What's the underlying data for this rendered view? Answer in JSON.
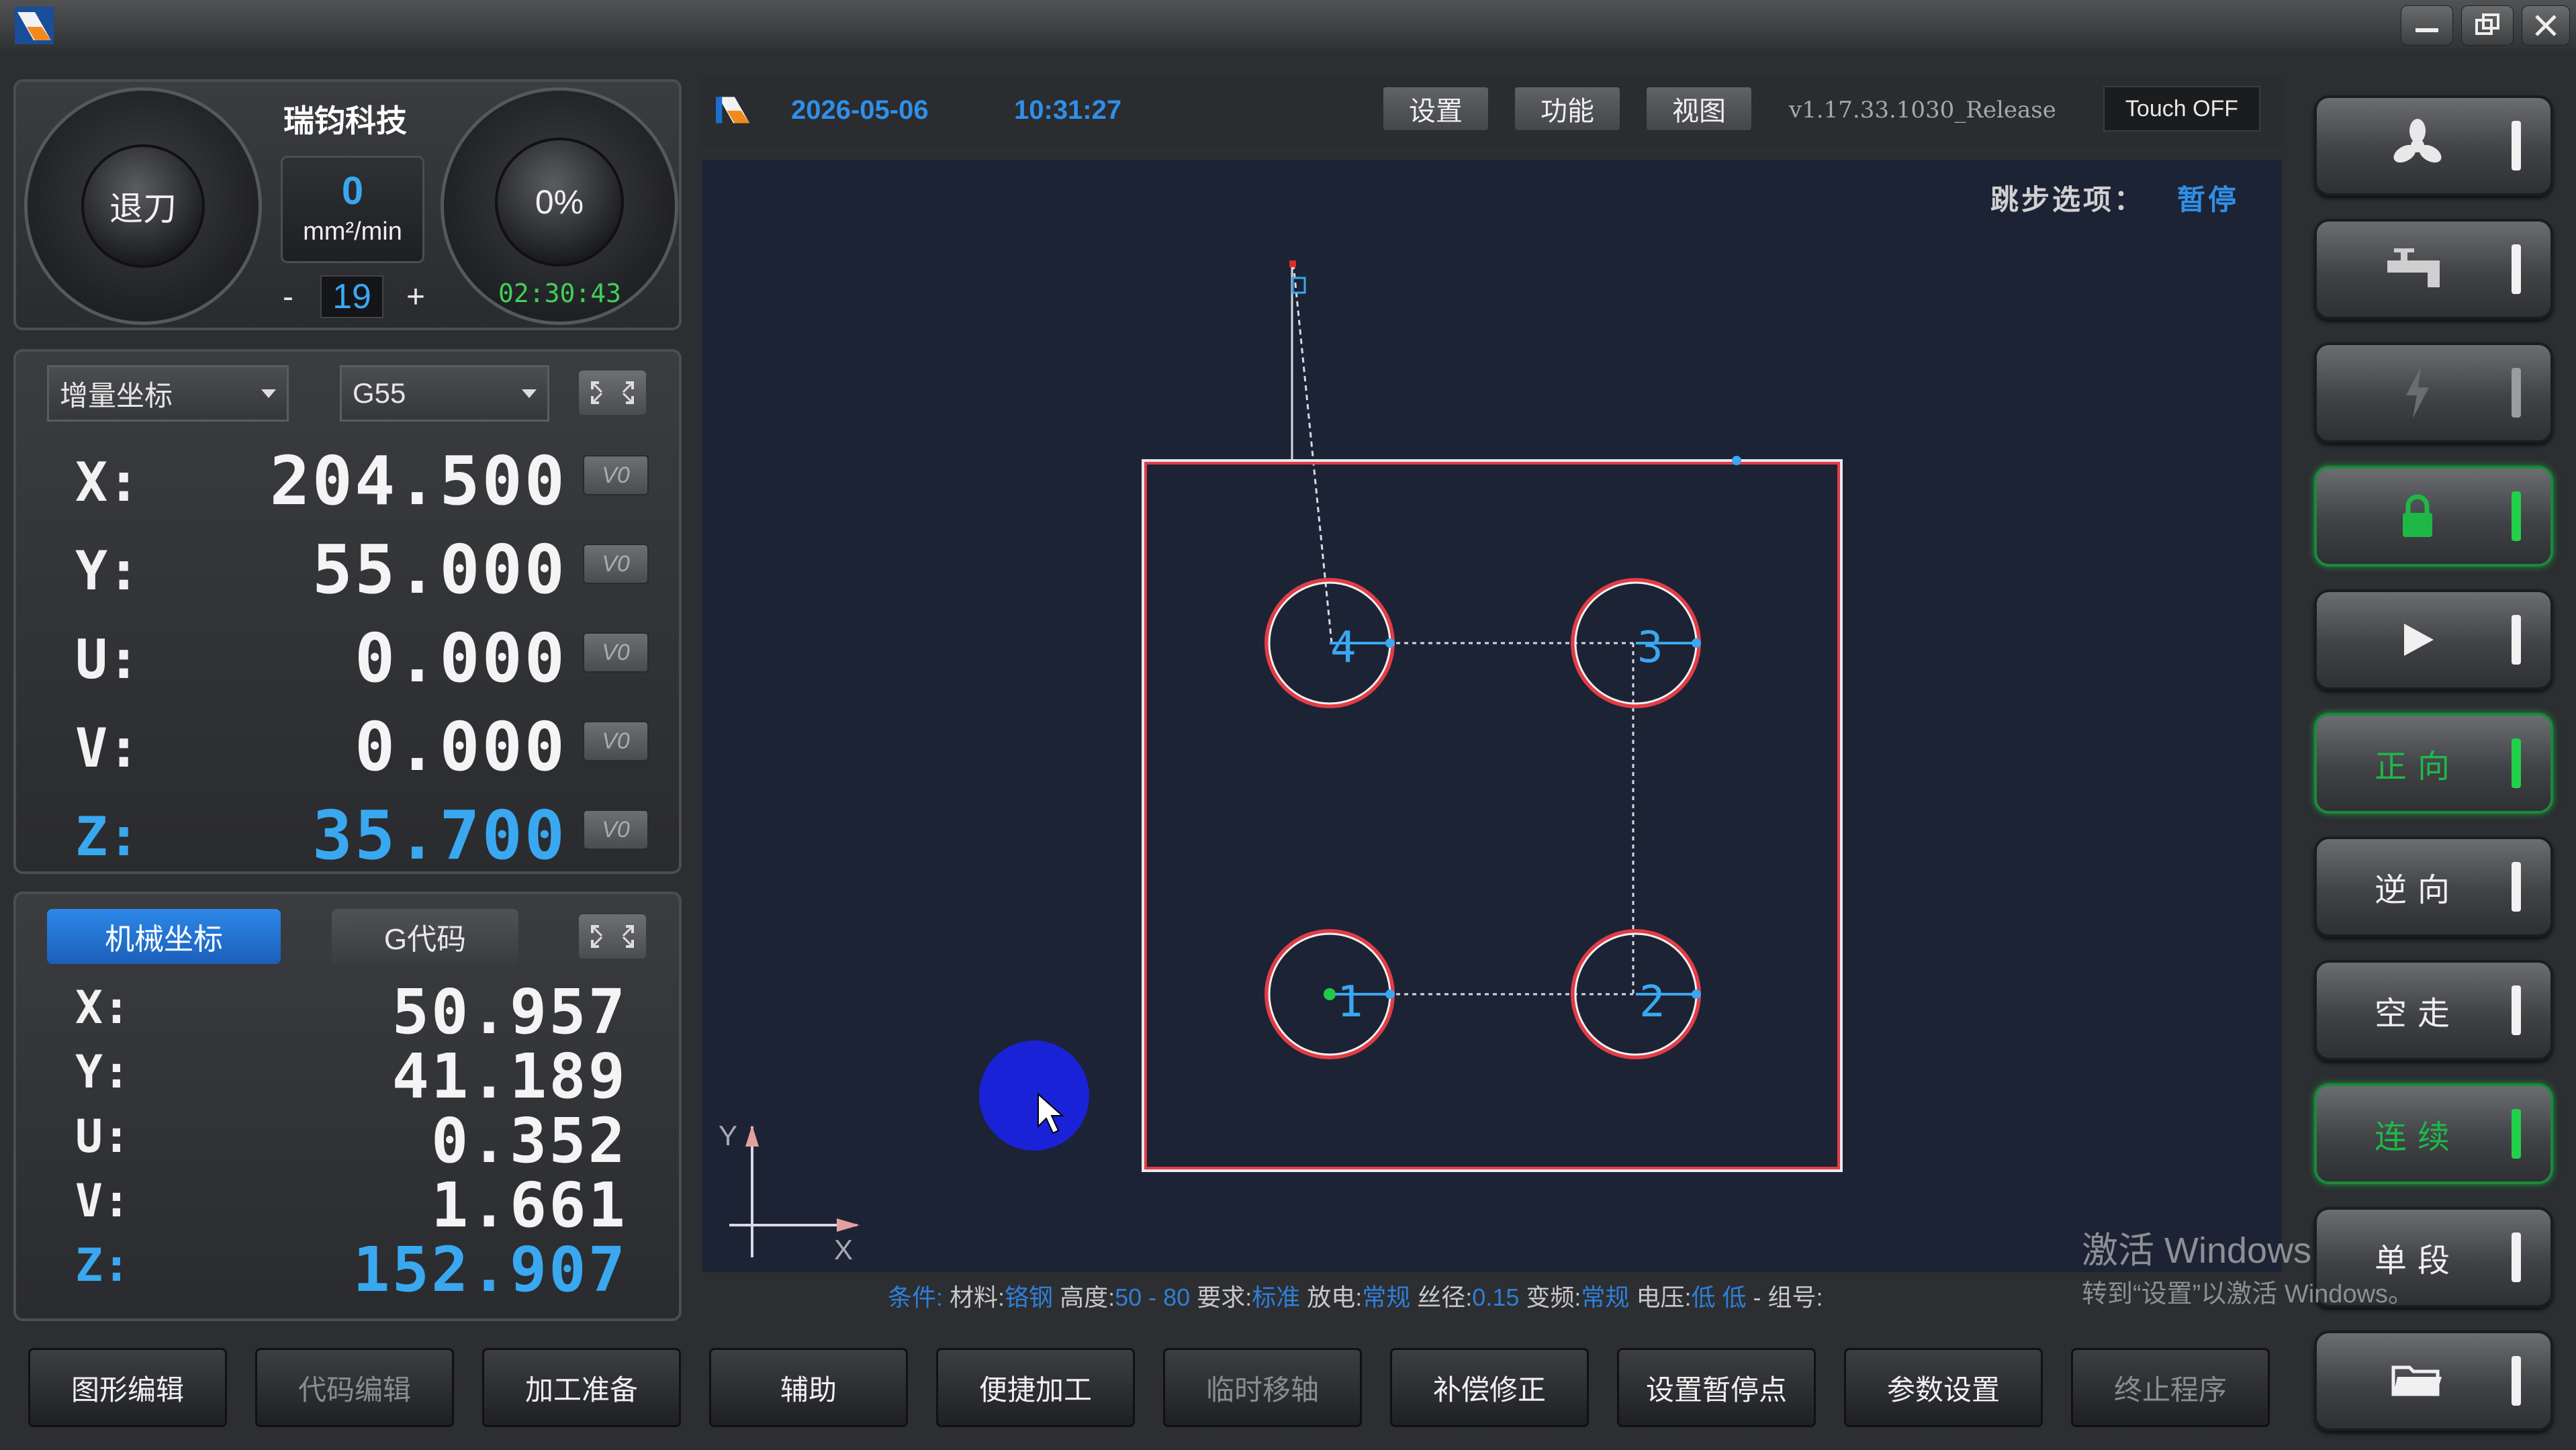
{
  "colors": {
    "accent_blue": "#3aa8f0",
    "active_green": "#22d04a",
    "canvas_bg": "#1c2335",
    "part_outline": "#e23c46",
    "tab_active": "#1f6fd0"
  },
  "dials": {
    "left_label": "退刀",
    "feed_value": "0",
    "feed_unit": "mm²/min",
    "step_minus": "-",
    "step_value": "19",
    "step_plus": "+",
    "right_percent": "0%",
    "timer": "02:30:43"
  },
  "brand": "瑞钧科技",
  "coords_top": {
    "mode": "增量坐标",
    "workcs": "G55",
    "axes": [
      {
        "label": "X:",
        "value": "204.500",
        "btn": "V0"
      },
      {
        "label": "Y:",
        "value": "55.000",
        "btn": "V0"
      },
      {
        "label": "U:",
        "value": "0.000",
        "btn": "V0"
      },
      {
        "label": "V:",
        "value": "0.000",
        "btn": "V0"
      },
      {
        "label": "Z:",
        "value": "35.700",
        "btn": "V0"
      }
    ]
  },
  "coords_bottom": {
    "tab_machine": "机械坐标",
    "tab_gcode": "G代码",
    "axes": [
      {
        "label": "X:",
        "value": "50.957"
      },
      {
        "label": "Y:",
        "value": "41.189"
      },
      {
        "label": "U:",
        "value": "0.352"
      },
      {
        "label": "V:",
        "value": "1.661"
      },
      {
        "label": "Z:",
        "value": "152.907"
      }
    ]
  },
  "topbar": {
    "date": "2026-05-06",
    "time": "10:31:27",
    "btn_settings": "设置",
    "btn_function": "功能",
    "btn_view": "视图",
    "version": "v1.17.33.1030_Release",
    "touch": "Touch OFF"
  },
  "canvas": {
    "skip_label": "跳步选项：",
    "skip_value": "暂停",
    "axis_y": "Y",
    "axis_x": "X",
    "hole_numbers": [
      "1",
      "2",
      "3",
      "4"
    ]
  },
  "status": {
    "t1": "条件:",
    "t2": "材料:",
    "material": "铬钢",
    "t3": "高度:",
    "height": "50 - 80",
    "t4": "要求:",
    "req": "标准",
    "t5": "放电:",
    "discharge": "常规",
    "t6": "丝径:",
    "wire": "0.15",
    "t7": "变频:",
    "freq": "常规",
    "t8": "电压:",
    "voltage": "低 低",
    "t9": "- 组号:"
  },
  "watermark": {
    "line1": "激活 Windows",
    "line2": "转到“设置”以激活 Windows。"
  },
  "right_buttons": [
    {
      "icon": "fan-icon",
      "label": ""
    },
    {
      "icon": "faucet-icon",
      "label": ""
    },
    {
      "icon": "lightning-icon",
      "label": ""
    },
    {
      "icon": "lock-icon",
      "label": ""
    },
    {
      "icon": "play-icon",
      "label": ""
    },
    {
      "icon": "",
      "label": "正向"
    },
    {
      "icon": "",
      "label": "逆向"
    },
    {
      "icon": "",
      "label": "空走"
    },
    {
      "icon": "",
      "label": "连续"
    },
    {
      "icon": "",
      "label": "单段"
    },
    {
      "icon": "folder-icon",
      "label": ""
    }
  ],
  "bottom_buttons": [
    "图形编辑",
    "代码编辑",
    "加工准备",
    "辅助",
    "便捷加工",
    "临时移轴",
    "补偿修正",
    "设置暂停点",
    "参数设置",
    "终止程序"
  ]
}
